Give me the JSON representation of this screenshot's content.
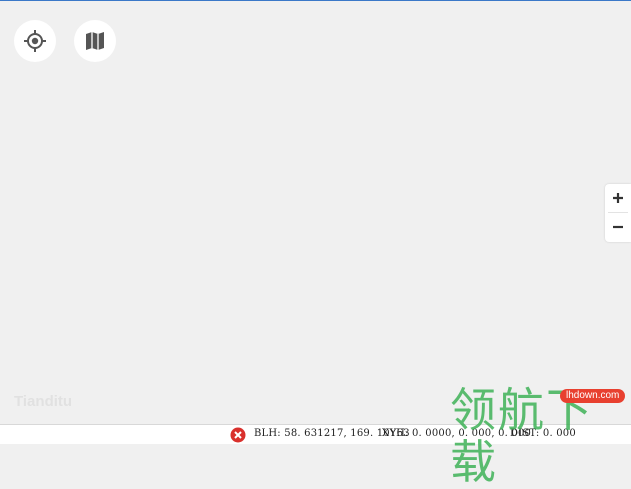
{
  "map": {
    "locate_icon": "crosshair-icon",
    "layers_icon": "map-icon",
    "zoom_in_label": "+",
    "zoom_out_label": "−",
    "faint_logo": "Tianditu"
  },
  "status_bar": {
    "error_icon": "error-icon",
    "blh": "BLH: 58. 631217, 169. 10Y63",
    "xyh": "XYH: 0. 0000, 0. 000, 0. 000",
    "dist": "DIST: 0. 000"
  },
  "watermark": {
    "text": "领航下载",
    "badge": "lhdown.com"
  },
  "colors": {
    "accent": "#3b78c8",
    "error": "#d9302c",
    "background": "#f0f0f0",
    "watermark_green": "#37af50",
    "badge_red": "#e8402f"
  }
}
